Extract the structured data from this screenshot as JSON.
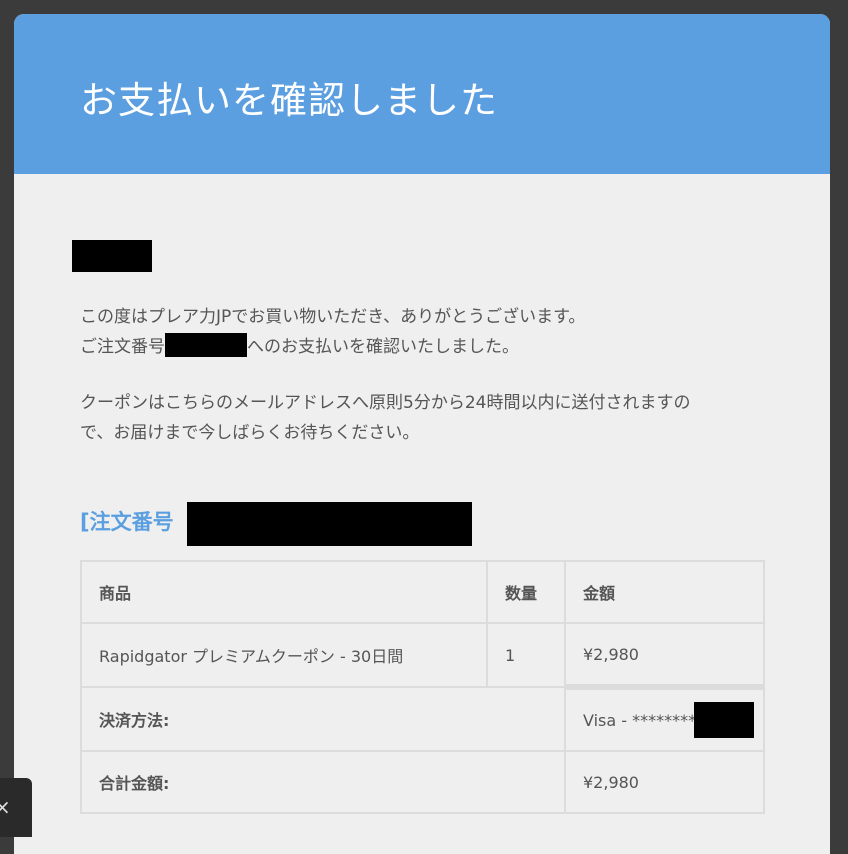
{
  "header": {
    "title": "お支払いを確認しました"
  },
  "message": {
    "line1": "この度はプレア力JPでお買い物いただき、ありがとうございます。",
    "line2_prefix": "ご注文番号",
    "line2_suffix": "へのお支払いを確認いたしました。",
    "line3": "クーポンはこちらのメールアドレスへ原則5分から24時間以内に送付されますの",
    "line4": "で、お届けまで今しばらくお待ちください。"
  },
  "order": {
    "heading_prefix": "[注文番号"
  },
  "table": {
    "headers": {
      "product": "商品",
      "quantity": "数量",
      "amount": "金額"
    },
    "item": {
      "product": "Rapidgator プレミアムクーポン - 30日間",
      "quantity": "1",
      "amount": "¥2,980"
    },
    "payment": {
      "label": "決済方法:",
      "value": "Visa - ********"
    },
    "total": {
      "label": "合計金額:",
      "value": "¥2,980"
    }
  },
  "side_tab": {
    "icon": "close-icon",
    "glyph": "×"
  }
}
